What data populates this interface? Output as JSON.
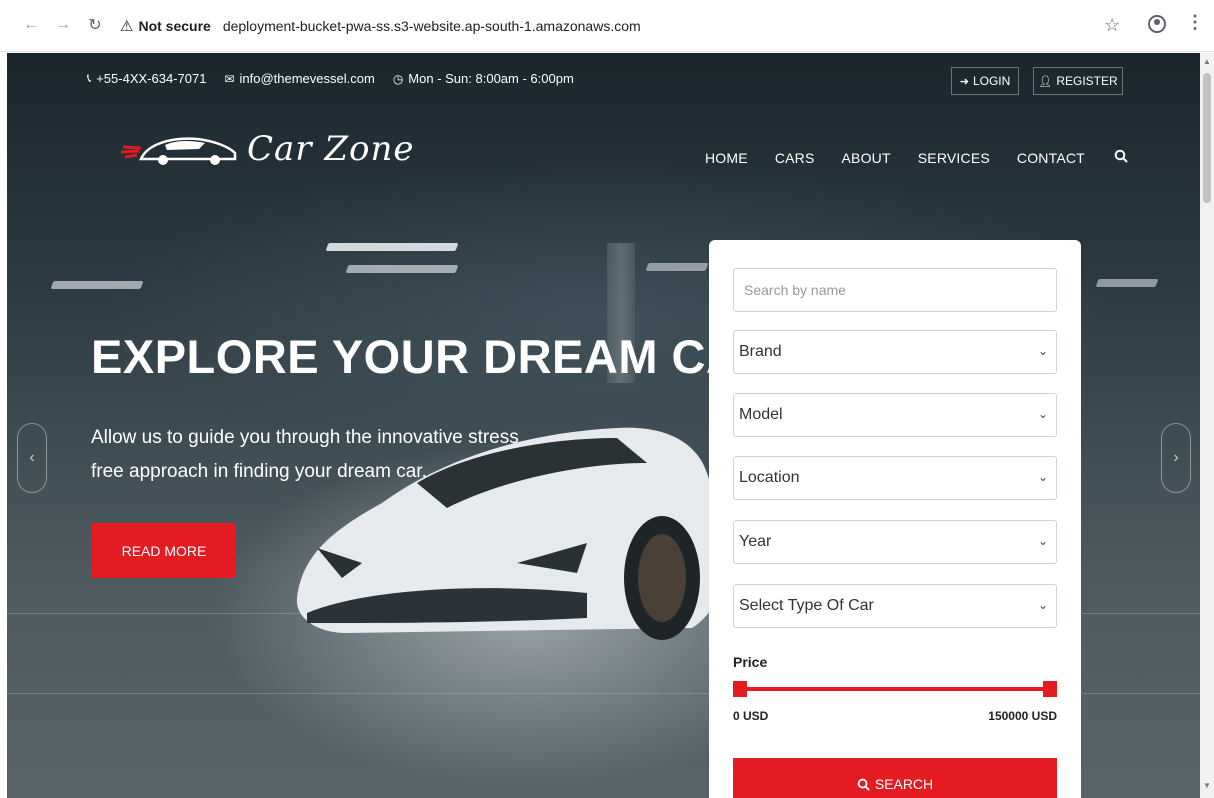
{
  "browser": {
    "security_label": "Not secure",
    "url": "deployment-bucket-pwa-ss.s3-website.ap-south-1.amazonaws.com"
  },
  "topbar": {
    "phone": "+55-4XX-634-7071",
    "email": "info@themevessel.com",
    "hours": "Mon - Sun: 8:00am - 6:00pm",
    "login_label": "LOGIN",
    "register_label": "REGISTER"
  },
  "logo": {
    "text": "Car Zone"
  },
  "nav": {
    "items": [
      "HOME",
      "CARS",
      "ABOUT",
      "SERVICES",
      "CONTACT"
    ]
  },
  "hero": {
    "title": "EXPLORE YOUR DREAM CAR",
    "subtitle": "Allow us to guide you through the innovative stress free approach in finding your dream car.",
    "cta_label": "READ MORE"
  },
  "search_panel": {
    "name_placeholder": "Search by name",
    "brand": "Brand",
    "model": "Model",
    "location": "Location",
    "year": "Year",
    "type": "Select Type Of Car",
    "price_label": "Price",
    "price_min": "0 USD",
    "price_max": "150000 USD",
    "search_label": "SEARCH"
  },
  "colors": {
    "accent": "#e41b23"
  }
}
